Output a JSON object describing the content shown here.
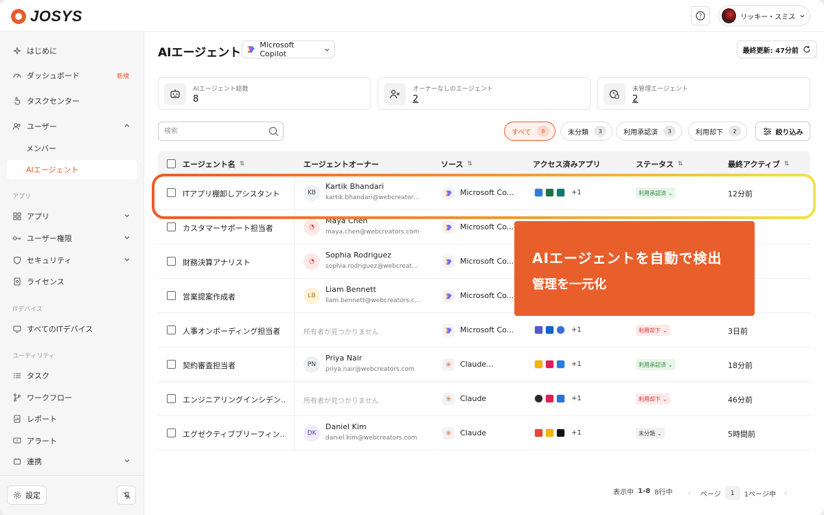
{
  "brand": {
    "name": "JOSYS"
  },
  "header": {
    "user_name": "リッキー・スミス"
  },
  "sidebar": {
    "items": [
      {
        "label": "はじめに"
      },
      {
        "label": "ダッシュボード",
        "badge": "新規"
      },
      {
        "label": "タスクセンター"
      },
      {
        "label": "ユーザー"
      },
      {
        "label": "メンバー"
      },
      {
        "label": "AIエージェント"
      },
      {
        "label": "アプリ"
      },
      {
        "label": "ユーザー権限"
      },
      {
        "label": "セキュリティ"
      },
      {
        "label": "ライセンス"
      },
      {
        "label": "すべてのITデバイス"
      },
      {
        "label": "タスク"
      },
      {
        "label": "ワークフロー"
      },
      {
        "label": "レポート"
      },
      {
        "label": "アラート"
      },
      {
        "label": "連携"
      }
    ],
    "sections": {
      "apps": "アプリ",
      "devices": "ITデバイス",
      "utilities": "ユーティリティ"
    },
    "settings_label": "設定"
  },
  "main": {
    "title": "AIエージェント",
    "source_select": "Microsoft Copilot",
    "last_update": "最終更新: 47分前",
    "stats": [
      {
        "label": "AIエージェント総数",
        "value": "8"
      },
      {
        "label": "オーナーなしのエージェント",
        "value": "2"
      },
      {
        "label": "未管理エージェント",
        "value": "2"
      }
    ],
    "search_placeholder": "検索",
    "filters": [
      {
        "label": "すべて",
        "count": "8"
      },
      {
        "label": "未分類",
        "count": "3"
      },
      {
        "label": "利用承認済",
        "count": "3"
      },
      {
        "label": "利用却下",
        "count": "2"
      }
    ],
    "filter_button": "絞り込み",
    "columns": [
      "エージェント名",
      "エージェントオーナー",
      "ソース",
      "アクセス済みアプリ",
      "ステータス",
      "最終アクティブ"
    ],
    "rows": [
      {
        "name": "ITアプリ棚卸しアシスタント",
        "owner_initials": "KB",
        "owner_name": "Kartik Bhandari",
        "owner_email": "kartik.bhandari@webcreators.com",
        "source": "Microsoft Co...",
        "apps_more": "+1",
        "status": "利用承認済",
        "last_active": "12分前"
      },
      {
        "name": "カスタマーサポート担当者",
        "owner_initials": "",
        "owner_name": "Maya Chen",
        "owner_email": "maya.chen@webcreators.com",
        "source": "Microsoft Co...",
        "apps_more": "",
        "status": "",
        "last_active": ""
      },
      {
        "name": "財務決算アナリスト",
        "owner_initials": "",
        "owner_name": "Sophia Rodriguez",
        "owner_email": "sophia.rodriguez@webcreators.com",
        "source": "Microsoft Co...",
        "apps_more": "",
        "status": "",
        "last_active": ""
      },
      {
        "name": "営業提案作成者",
        "owner_initials": "LB",
        "owner_name": "Liam Bennett",
        "owner_email": "liam.bennett@webcreators.com",
        "source": "Microsoft Co...",
        "apps_more": "",
        "status": "",
        "last_active": ""
      },
      {
        "name": "人事オンボーディング担当者",
        "owner_initials": "",
        "owner_name": "",
        "owner_email": "",
        "no_owner": "所有者が見つかりません",
        "source": "Microsoft Co...",
        "apps_more": "+1",
        "status": "利用却下",
        "last_active": "3日前"
      },
      {
        "name": "契約審査担当者",
        "owner_initials": "PN",
        "owner_name": "Priya Nair",
        "owner_email": "priya.nair@webcreators.com",
        "source": "Claude...",
        "apps_more": "+1",
        "status": "利用承認済",
        "last_active": "18分前"
      },
      {
        "name": "エンジニアリングインシデン...",
        "owner_initials": "",
        "owner_name": "",
        "owner_email": "",
        "no_owner": "所有者が見つかりません",
        "source": "Claude",
        "apps_more": "+1",
        "status": "利用却下",
        "last_active": "46分前"
      },
      {
        "name": "エグゼクティブブリーフィン...",
        "owner_initials": "DK",
        "owner_name": "Daniel Kim",
        "owner_email": "daniel.kim@webcreators.com",
        "source": "Claude",
        "apps_more": "+1",
        "status": "未分類",
        "last_active": "5時間前"
      }
    ],
    "pager": {
      "showing": "表示中",
      "range": "1-8",
      "total": "8行中",
      "page_label": "ページ",
      "page": "1",
      "of": "1ページ中"
    }
  },
  "callout": {
    "line1": "AIエージェントを自動で検出",
    "line2": "管理を一元化"
  },
  "colors": {
    "accent": "#ea5b2a",
    "callout_bg": "#e95f2c"
  }
}
